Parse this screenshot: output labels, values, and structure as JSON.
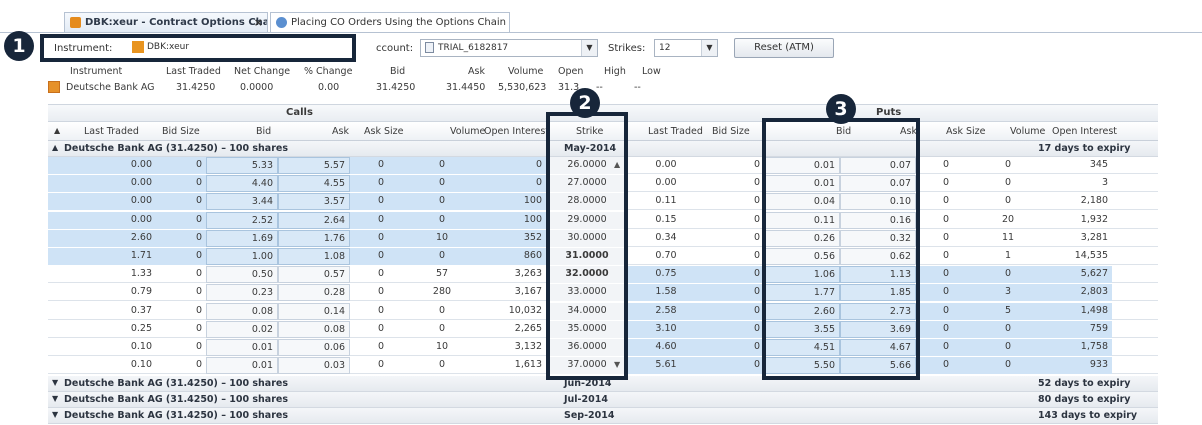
{
  "tabs": [
    {
      "label": "DBK:xeur - Contract Options Chain",
      "close": "×"
    },
    {
      "label": "Placing CO Orders Using the Options Chain"
    }
  ],
  "params": {
    "instrument_label": "Instrument:",
    "instrument_value": "DBK:xeur",
    "account_label": "ccount:",
    "account_value": "TRIAL_6182817",
    "strikes_label": "Strikes:",
    "strikes_value": "12",
    "reset_label": "Reset (ATM)"
  },
  "callouts": [
    "1",
    "2",
    "3"
  ],
  "quote": {
    "headers": [
      "Instrument",
      "Last Traded",
      "Net Change",
      "% Change",
      "Bid",
      "Ask",
      "Volume",
      "Open",
      "High",
      "Low"
    ],
    "values": [
      "Deutsche Bank AG",
      "31.4250",
      "0.0000",
      "0.00",
      "31.4250",
      "31.4450",
      "5,530,623",
      "31.3",
      "--",
      "--"
    ]
  },
  "groups": {
    "calls": "Calls",
    "puts": "Puts"
  },
  "columns": [
    "Last Traded",
    "Bid Size",
    "Bid",
    "Ask",
    "Ask Size",
    "Volume",
    "Open Interest",
    "Strike",
    "Last Traded",
    "Bid Size",
    "Bid",
    "Ask",
    "Ask Size",
    "Volume",
    "Open Interest"
  ],
  "expiries": [
    {
      "label": "Deutsche Bank AG (31.4250) – 100 shares",
      "month": "May-2014",
      "expiry": "17 days to expiry"
    },
    {
      "label": "Deutsche Bank AG (31.4250) – 100 shares",
      "month": "Jun-2014",
      "expiry": "52 days to expiry"
    },
    {
      "label": "Deutsche Bank AG (31.4250) – 100 shares",
      "month": "Jul-2014",
      "expiry": "80 days to expiry"
    },
    {
      "label": "Deutsche Bank AG (31.4250) – 100 shares",
      "month": "Sep-2014",
      "expiry": "143 days to expiry"
    }
  ],
  "rows": [
    {
      "c_last": "0.00",
      "c_bsz": "0",
      "c_bid": "5.33",
      "c_ask": "5.57",
      "c_asz": "0",
      "c_vol": "0",
      "c_oi": "0",
      "strike": "26.0000",
      "p_last": "0.00",
      "p_bsz": "0",
      "p_bid": "0.01",
      "p_ask": "0.07",
      "p_asz": "0",
      "p_vol": "0",
      "p_oi": "345"
    },
    {
      "c_last": "0.00",
      "c_bsz": "0",
      "c_bid": "4.40",
      "c_ask": "4.55",
      "c_asz": "0",
      "c_vol": "0",
      "c_oi": "0",
      "strike": "27.0000",
      "p_last": "0.00",
      "p_bsz": "0",
      "p_bid": "0.01",
      "p_ask": "0.07",
      "p_asz": "0",
      "p_vol": "0",
      "p_oi": "3"
    },
    {
      "c_last": "0.00",
      "c_bsz": "0",
      "c_bid": "3.44",
      "c_ask": "3.57",
      "c_asz": "0",
      "c_vol": "0",
      "c_oi": "100",
      "strike": "28.0000",
      "p_last": "0.11",
      "p_bsz": "0",
      "p_bid": "0.04",
      "p_ask": "0.10",
      "p_asz": "0",
      "p_vol": "0",
      "p_oi": "2,180"
    },
    {
      "c_last": "0.00",
      "c_bsz": "0",
      "c_bid": "2.52",
      "c_ask": "2.64",
      "c_asz": "0",
      "c_vol": "0",
      "c_oi": "100",
      "strike": "29.0000",
      "p_last": "0.15",
      "p_bsz": "0",
      "p_bid": "0.11",
      "p_ask": "0.16",
      "p_asz": "0",
      "p_vol": "20",
      "p_oi": "1,932"
    },
    {
      "c_last": "2.60",
      "c_bsz": "0",
      "c_bid": "1.69",
      "c_ask": "1.76",
      "c_asz": "0",
      "c_vol": "10",
      "c_oi": "352",
      "strike": "30.0000",
      "p_last": "0.34",
      "p_bsz": "0",
      "p_bid": "0.26",
      "p_ask": "0.32",
      "p_asz": "0",
      "p_vol": "11",
      "p_oi": "3,281"
    },
    {
      "c_last": "1.71",
      "c_bsz": "0",
      "c_bid": "1.00",
      "c_ask": "1.08",
      "c_asz": "0",
      "c_vol": "0",
      "c_oi": "860",
      "strike": "31.0000",
      "p_last": "0.70",
      "p_bsz": "0",
      "p_bid": "0.56",
      "p_ask": "0.62",
      "p_asz": "0",
      "p_vol": "1",
      "p_oi": "14,535"
    },
    {
      "c_last": "1.33",
      "c_bsz": "0",
      "c_bid": "0.50",
      "c_ask": "0.57",
      "c_asz": "0",
      "c_vol": "57",
      "c_oi": "3,263",
      "strike": "32.0000",
      "p_last": "0.75",
      "p_bsz": "0",
      "p_bid": "1.06",
      "p_ask": "1.13",
      "p_asz": "0",
      "p_vol": "0",
      "p_oi": "5,627"
    },
    {
      "c_last": "0.79",
      "c_bsz": "0",
      "c_bid": "0.23",
      "c_ask": "0.28",
      "c_asz": "0",
      "c_vol": "280",
      "c_oi": "3,167",
      "strike": "33.0000",
      "p_last": "1.58",
      "p_bsz": "0",
      "p_bid": "1.77",
      "p_ask": "1.85",
      "p_asz": "0",
      "p_vol": "3",
      "p_oi": "2,803"
    },
    {
      "c_last": "0.37",
      "c_bsz": "0",
      "c_bid": "0.08",
      "c_ask": "0.14",
      "c_asz": "0",
      "c_vol": "0",
      "c_oi": "10,032",
      "strike": "34.0000",
      "p_last": "2.58",
      "p_bsz": "0",
      "p_bid": "2.60",
      "p_ask": "2.73",
      "p_asz": "0",
      "p_vol": "5",
      "p_oi": "1,498"
    },
    {
      "c_last": "0.25",
      "c_bsz": "0",
      "c_bid": "0.02",
      "c_ask": "0.08",
      "c_asz": "0",
      "c_vol": "0",
      "c_oi": "2,265",
      "strike": "35.0000",
      "p_last": "3.10",
      "p_bsz": "0",
      "p_bid": "3.55",
      "p_ask": "3.69",
      "p_asz": "0",
      "p_vol": "0",
      "p_oi": "759"
    },
    {
      "c_last": "0.10",
      "c_bsz": "0",
      "c_bid": "0.01",
      "c_ask": "0.06",
      "c_asz": "0",
      "c_vol": "10",
      "c_oi": "3,132",
      "strike": "36.0000",
      "p_last": "4.60",
      "p_bsz": "0",
      "p_bid": "4.51",
      "p_ask": "4.67",
      "p_asz": "0",
      "p_vol": "0",
      "p_oi": "1,758"
    },
    {
      "c_last": "0.10",
      "c_bsz": "0",
      "c_bid": "0.01",
      "c_ask": "0.03",
      "c_asz": "0",
      "c_vol": "0",
      "c_oi": "1,613",
      "strike": "37.0000",
      "p_last": "5.61",
      "p_bsz": "0",
      "p_bid": "5.50",
      "p_ask": "5.66",
      "p_asz": "0",
      "p_vol": "0",
      "p_oi": "933"
    }
  ],
  "scroll_up": "▲",
  "scroll_down": "▼",
  "colors": {
    "itm": "#cfe3f6",
    "callout": "#17263a",
    "icon": "#e58b1d"
  }
}
